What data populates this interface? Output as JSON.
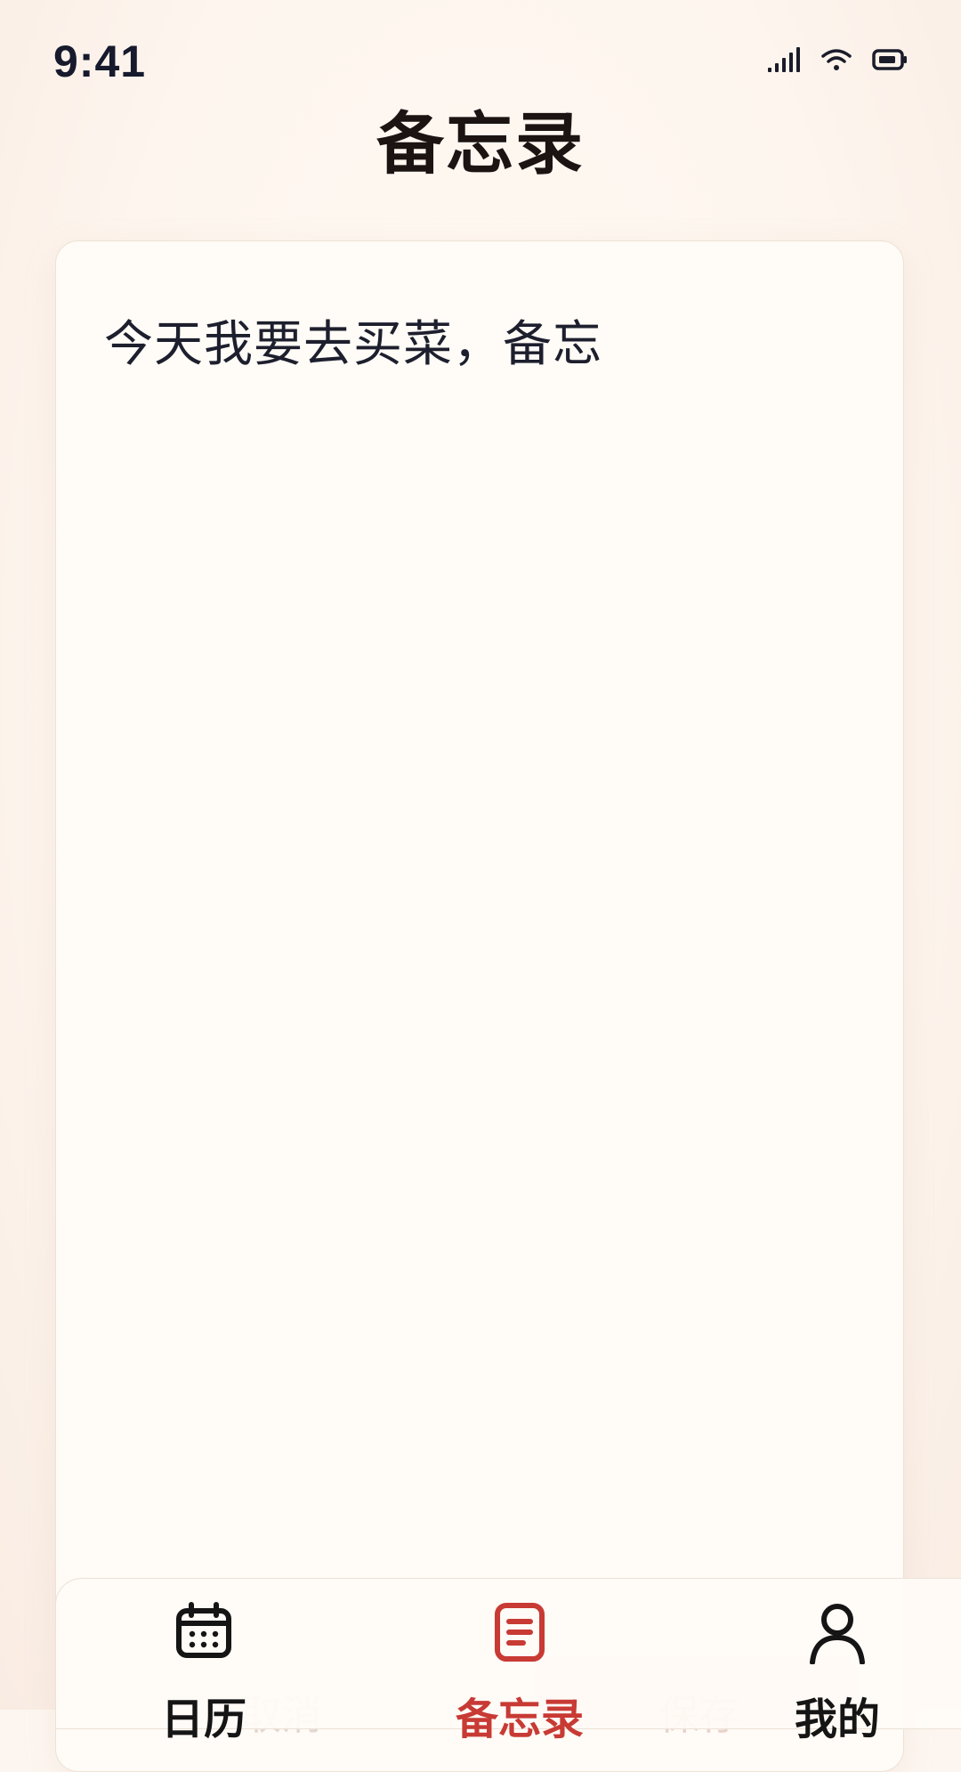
{
  "status_bar": {
    "time": "9:41",
    "icons": [
      "cellular-signal-icon",
      "wifi-icon",
      "battery-icon"
    ]
  },
  "header": {
    "title": "备忘录"
  },
  "memo": {
    "content": "今天我要去买菜，备忘"
  },
  "actions": {
    "cancel_label": "取消",
    "save_label": "保存"
  },
  "tab_bar": {
    "active": "memo",
    "items": [
      {
        "id": "calendar",
        "label": "日历",
        "icon": "calendar-icon"
      },
      {
        "id": "memo",
        "label": "备忘录",
        "icon": "memo-icon"
      },
      {
        "id": "mine",
        "label": "我的",
        "icon": "user-icon"
      }
    ]
  },
  "colors": {
    "background": "#fdf6f0",
    "card": "#fffbf6",
    "accent": "#c83a34",
    "text": "#1d1f2e"
  }
}
